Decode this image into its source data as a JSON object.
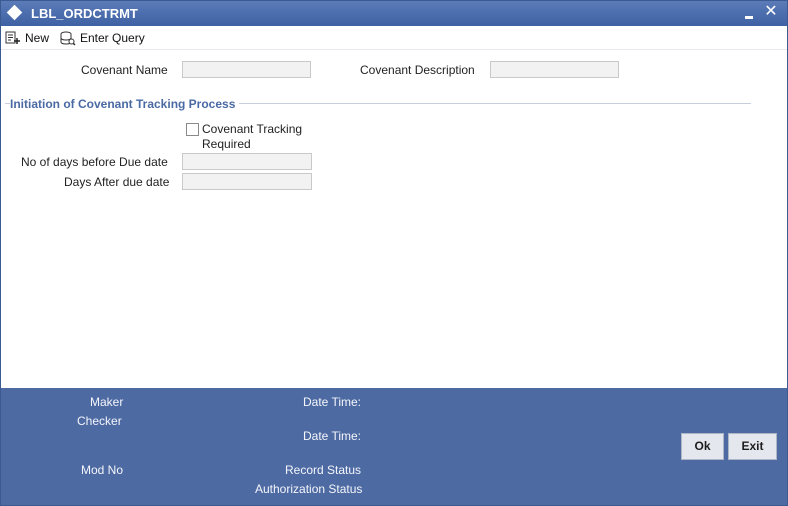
{
  "window": {
    "title": "LBL_ORDCTRMT"
  },
  "toolbar": {
    "new_label": "New",
    "enter_query_label": "Enter Query"
  },
  "form": {
    "covenant_name_label": "Covenant Name",
    "covenant_name_value": "",
    "covenant_description_label": "Covenant Description",
    "covenant_description_value": "",
    "section_title": "Initiation of Covenant Tracking Process",
    "tracking_required_label_line1": "Covenant Tracking",
    "tracking_required_label_line2": "Required",
    "tracking_required_checked": false,
    "days_before_label": "No of days before Due date",
    "days_before_value": "",
    "days_after_label": "Days After due date",
    "days_after_value": ""
  },
  "footer": {
    "maker_label": "Maker",
    "checker_label": "Checker",
    "date_time_label_1": "Date Time:",
    "date_time_label_2": "Date Time:",
    "mod_no_label": "Mod No",
    "record_status_label": "Record Status",
    "authorization_status_label": "Authorization Status",
    "ok_label": "Ok",
    "exit_label": "Exit"
  },
  "colors": {
    "titlebar": "#4a6cad",
    "footer": "#4e6aa3",
    "section_title": "#4a6aa3",
    "field_bg": "#f2f2f2"
  },
  "icons": [
    "app-diamond-icon",
    "new-document-icon",
    "enter-query-icon",
    "minimize-icon",
    "close-icon"
  ]
}
